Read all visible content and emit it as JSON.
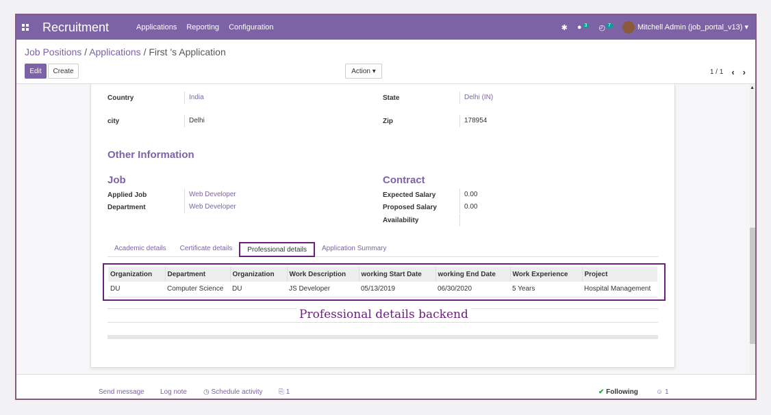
{
  "navbar": {
    "brand": "Recruitment",
    "menu": [
      "Applications",
      "Reporting",
      "Configuration"
    ],
    "messages_badge": "3",
    "activities_badge": "7",
    "user": "Mitchell Admin (job_portal_v13)"
  },
  "breadcrumb": {
    "job_positions": "Job Positions",
    "applications": "Applications",
    "current": "First 's Application",
    "sep": "/"
  },
  "buttons": {
    "edit": "Edit",
    "create": "Create",
    "action": "Action ▾"
  },
  "pager": {
    "value": "1 / 1"
  },
  "address": {
    "country_label": "Country",
    "country_value": "India",
    "state_label": "State",
    "state_value": "Delhi (IN)",
    "city_label": "city",
    "city_value": "Delhi",
    "zip_label": "Zip",
    "zip_value": "178954"
  },
  "other_info": {
    "title": "Other Information",
    "job_title": "Job",
    "applied_job_label": "Applied Job",
    "applied_job_value": "Web Developer",
    "department_label": "Department",
    "department_value": "Web Developer",
    "contract_title": "Contract",
    "expected_salary_label": "Expected Salary",
    "expected_salary_value": "0.00",
    "proposed_salary_label": "Proposed Salary",
    "proposed_salary_value": "0.00",
    "availability_label": "Availability"
  },
  "tabs": [
    "Academic details",
    "Certificate details",
    "Professional details",
    "Application Summary"
  ],
  "table": {
    "headers": [
      "Organization",
      "Department",
      "Organization",
      "Work Description",
      "working Start Date",
      "working End Date",
      "Work Experience",
      "Project"
    ],
    "rows": [
      [
        "DU",
        "Computer Science",
        "DU",
        "JS Developer",
        "05/13/2019",
        "06/30/2020",
        "5 Years",
        "Hospital Management"
      ]
    ]
  },
  "annotation": "Professional details backend",
  "chatter": {
    "send_message": "Send message",
    "log_note": "Log note",
    "schedule_activity": "Schedule activity",
    "attachments": "1",
    "following": "Following",
    "followers": "1"
  }
}
